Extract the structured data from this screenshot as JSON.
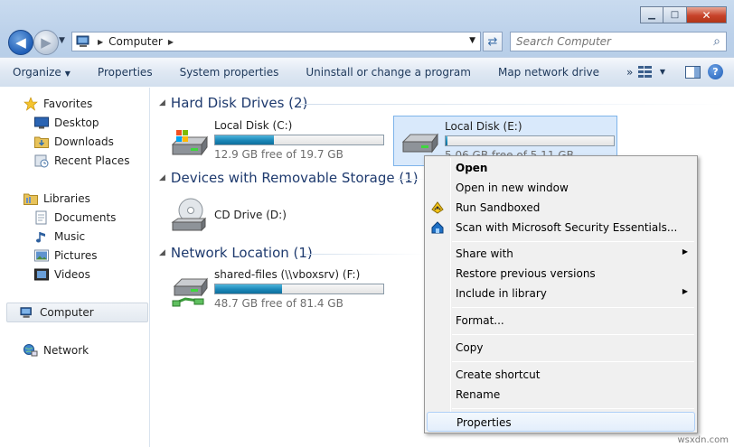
{
  "window": {
    "minimize": "▁",
    "maximize": "□",
    "close": "✕"
  },
  "address": {
    "path": "Computer",
    "search_placeholder": "Search Computer"
  },
  "toolbar": {
    "items": [
      "Organize",
      "Properties",
      "System properties",
      "Uninstall or change a program",
      "Map network drive",
      "»"
    ]
  },
  "nav": {
    "favorites": "Favorites",
    "desktop": "Desktop",
    "downloads": "Downloads",
    "recent": "Recent Places",
    "libraries": "Libraries",
    "documents": "Documents",
    "music": "Music",
    "pictures": "Pictures",
    "videos": "Videos",
    "computer": "Computer",
    "network": "Network"
  },
  "groups": {
    "hdd": "Hard Disk Drives (2)",
    "removable": "Devices with Removable Storage (1)",
    "network": "Network Location (1)"
  },
  "drives": [
    {
      "name": "Local Disk (C:)",
      "free": "12.9 GB free of 19.7 GB",
      "used_fraction": 0.35
    },
    {
      "name": "Local Disk (E:)",
      "free": "5.06 GB free of 5.11 GB",
      "used_fraction": 0.01
    },
    {
      "name": "CD Drive (D:)"
    },
    {
      "name": "shared-files (\\\\vboxsrv) (F:)",
      "free": "48.7 GB free of 81.4 GB",
      "used_fraction": 0.4
    }
  ],
  "context_menu": {
    "open": "Open",
    "open_new_window": "Open in new window",
    "run_sandboxed": "Run Sandboxed",
    "scan": "Scan with Microsoft Security Essentials...",
    "share_with": "Share with",
    "restore": "Restore previous versions",
    "include_library": "Include in library",
    "format": "Format...",
    "copy": "Copy",
    "create_shortcut": "Create shortcut",
    "rename": "Rename",
    "properties": "Properties"
  },
  "watermark": "wsxdn.com",
  "colors": {
    "accent": "#1b87b8",
    "selection": "#d9e9fb",
    "group_header": "#1e3a6e"
  }
}
